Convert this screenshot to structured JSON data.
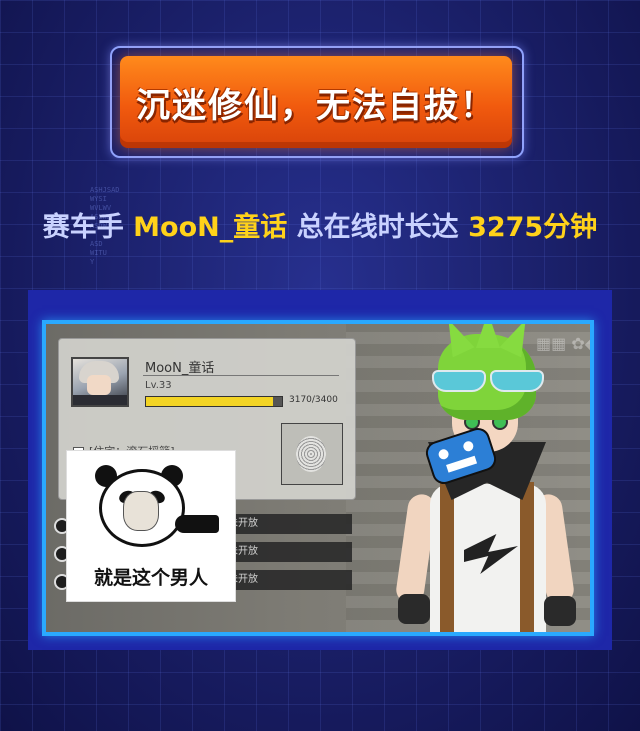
{
  "banner": {
    "title": "沉迷修仙，无法自拔！"
  },
  "stat": {
    "prefix": "赛车手",
    "player_name": "MooN_童话",
    "middle": "总在线时长达",
    "minutes": "3275分钟"
  },
  "decor": {
    "code_text": "ASHJSAD\nWYSI\nWVLWV\nASLWK\nASDW\n\nASD\nWITU\nY"
  },
  "game_screenshot": {
    "profile": {
      "name": "MooN_童话",
      "level": "Lv.33",
      "xp_text": "3170/3400",
      "xp_fraction": 0.932,
      "residence": "[住宅：滚石摇篮]"
    },
    "rows": [
      {
        "label": "未开放"
      },
      {
        "label": "未开放"
      },
      {
        "label": "未开放"
      }
    ],
    "meme_caption": "就是这个男人"
  },
  "colors": {
    "highlight": "#ffd21a",
    "stat_text": "#c9d2ff",
    "banner_orange": "#f15a0e",
    "frame_blue": "#2aa9ff"
  }
}
